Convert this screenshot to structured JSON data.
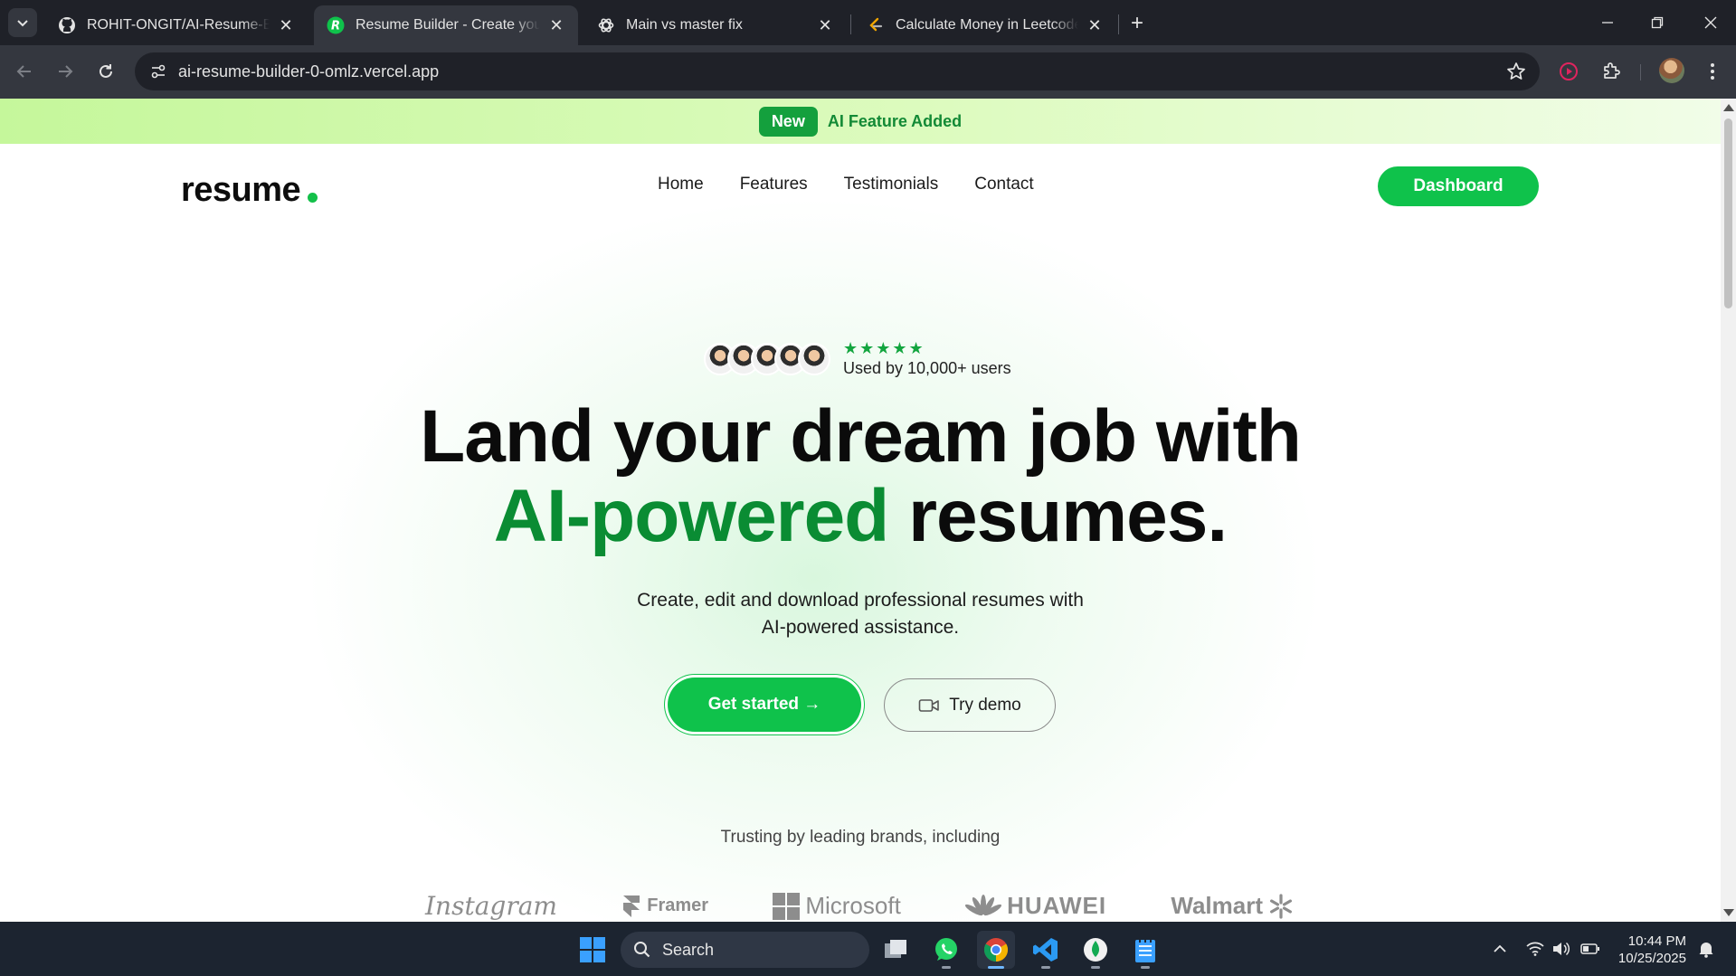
{
  "browser": {
    "tabs": [
      {
        "title": "ROHIT-ONGIT/AI-Resume-Builder",
        "icon": "github-icon"
      },
      {
        "title": "Resume Builder - Create your resume",
        "icon": "resume-builder-favicon"
      },
      {
        "title": "Main vs master fix",
        "icon": "chatgpt-icon"
      },
      {
        "title": "Calculate Money in Leetcode Bank",
        "icon": "leetcode-icon"
      }
    ],
    "url": "ai-resume-builder-0-omlz.vercel.app"
  },
  "page": {
    "banner": {
      "badge": "New",
      "text": "AI Feature Added"
    },
    "logo": "resume",
    "nav": [
      "Home",
      "Features",
      "Testimonials",
      "Contact"
    ],
    "dashboard_button": "Dashboard",
    "social_proof": {
      "rating": 5,
      "stars": "★★★★★",
      "text": "Used by 10,000+ users"
    },
    "hero": {
      "line1": "Land your dream job with",
      "highlight": "AI-powered",
      "rest": " resumes."
    },
    "subtitle": {
      "line1": "Create, edit and download professional resumes with",
      "line2": "AI-powered assistance."
    },
    "get_started": "Get started →",
    "try_demo": "Try demo",
    "trust_text": "Trusting by leading brands, including",
    "brands": [
      "Instagram",
      "Framer",
      "Microsoft",
      "HUAWEI",
      "Walmart"
    ]
  },
  "taskbar": {
    "search": "Search",
    "time": "10:44 PM",
    "date": "10/25/2025"
  },
  "colors": {
    "accent": "#0fc24b",
    "accent_dark": "#0a8c33",
    "banner": "#c5f79b"
  }
}
